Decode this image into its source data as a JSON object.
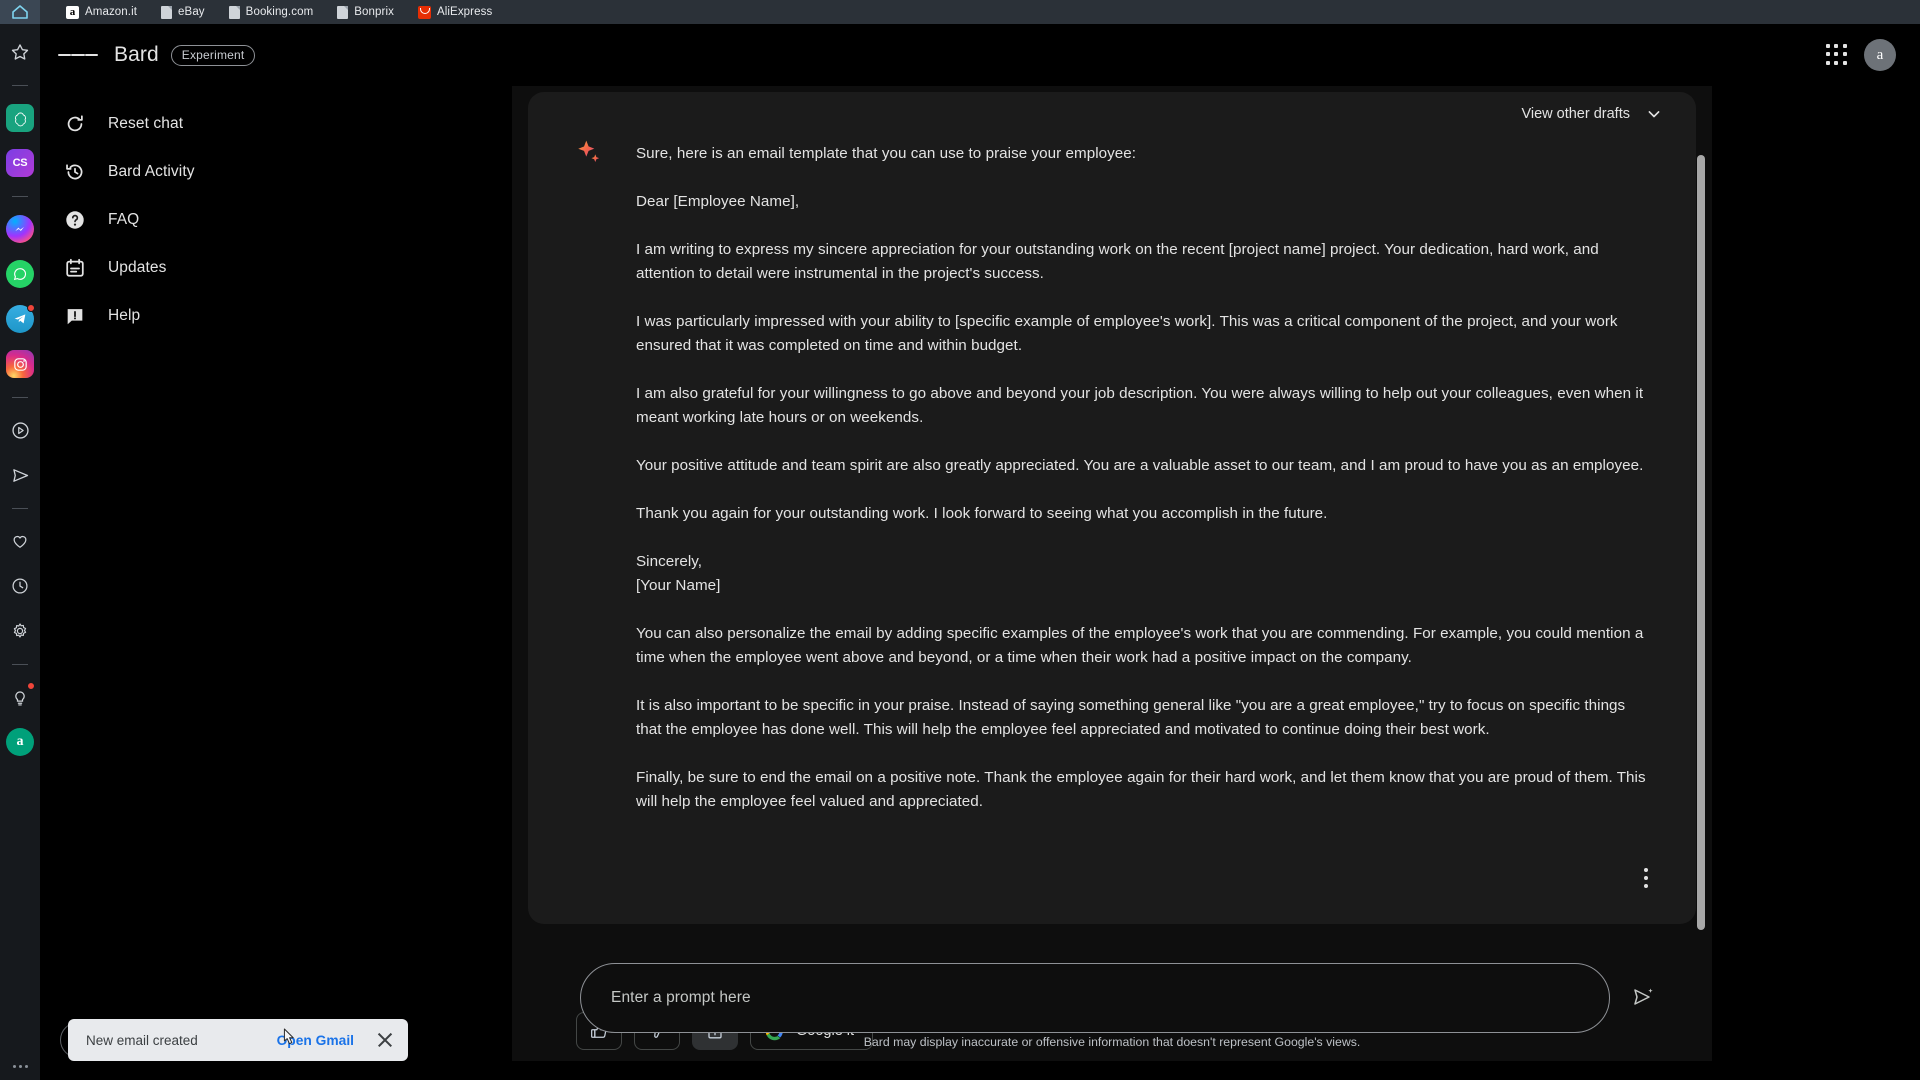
{
  "browser": {
    "home_icon": "home-icon",
    "bookmarks": [
      {
        "label": "Amazon.it",
        "icon": "amazon-favicon"
      },
      {
        "label": "eBay",
        "icon": "document-favicon"
      },
      {
        "label": "Booking.com",
        "icon": "document-favicon"
      },
      {
        "label": "Bonprix",
        "icon": "document-favicon"
      },
      {
        "label": "AliExpress",
        "icon": "aliexpress-favicon"
      }
    ]
  },
  "rail": {
    "items": [
      {
        "name": "star-icon",
        "label": "Star"
      },
      {
        "name": "separator",
        "label": ""
      },
      {
        "name": "chatgpt-icon",
        "label": "ChatGPT"
      },
      {
        "name": "cs-icon",
        "label": "CS"
      },
      {
        "name": "separator",
        "label": ""
      },
      {
        "name": "messenger-icon",
        "label": "Messenger"
      },
      {
        "name": "whatsapp-icon",
        "label": "WhatsApp"
      },
      {
        "name": "telegram-icon",
        "label": "Telegram"
      },
      {
        "name": "instagram-icon",
        "label": "Instagram"
      },
      {
        "name": "separator",
        "label": ""
      },
      {
        "name": "play-circle-icon",
        "label": "Play"
      },
      {
        "name": "send-icon",
        "label": "Send"
      },
      {
        "name": "separator",
        "label": ""
      },
      {
        "name": "heart-icon",
        "label": "Favorites"
      },
      {
        "name": "clock-icon",
        "label": "History"
      },
      {
        "name": "gear-icon",
        "label": "Settings"
      },
      {
        "name": "separator",
        "label": ""
      },
      {
        "name": "lightbulb-icon",
        "label": "Tips"
      },
      {
        "name": "account-a-icon",
        "label": "a"
      }
    ],
    "overflow": "more-options"
  },
  "header": {
    "menu_icon": "hamburger-icon",
    "title": "Bard",
    "badge": "Experiment",
    "apps_icon": "google-apps-icon",
    "avatar_initial": "a"
  },
  "sidenav": {
    "items": [
      {
        "label": "Reset chat",
        "icon": "reset-icon"
      },
      {
        "label": "Bard Activity",
        "icon": "history-icon"
      },
      {
        "label": "FAQ",
        "icon": "help-circle-icon"
      },
      {
        "label": "Updates",
        "icon": "calendar-icon"
      },
      {
        "label": "Help",
        "icon": "feedback-icon"
      }
    ]
  },
  "drafts": {
    "label": "View other drafts",
    "chevron": "chevron-down-icon"
  },
  "response": {
    "avatar_icon": "bard-sparkle-icon",
    "paragraphs": [
      "Sure, here is an email template that you can use to praise your employee:",
      "Dear [Employee Name],",
      "I am writing to express my sincere appreciation for your outstanding work on the recent [project name] project. Your dedication, hard work, and attention to detail were instrumental in the project's success.",
      "I was particularly impressed with your ability to [specific example of employee's work]. This was a critical component of the project, and your work ensured that it was completed on time and within budget.",
      "I am also grateful for your willingness to go above and beyond your job description. You were always willing to help out your colleagues, even when it meant working late hours or on weekends.",
      "Your positive attitude and team spirit are also greatly appreciated. You are a valuable asset to our team, and I am proud to have you as an employee.",
      "Thank you again for your outstanding work. I look forward to seeing what you accomplish in the future.",
      "Sincerely,",
      "[Your Name]",
      "You can also personalize the email by adding specific examples of the employee's work that you are commending. For example, you could mention a time when the employee went above and beyond, or a time when their work had a positive impact on the company.",
      "It is also important to be specific in your praise. Instead of saying something general like \"you are a great employee,\" try to focus on specific things that the employee has done well. This will help the employee feel appreciated and motivated to continue doing their best work.",
      "Finally, be sure to end the email on a positive note. Thank the employee again for their hard work, and let them know that you are proud of them. This will help the employee feel valued and appreciated."
    ]
  },
  "actions": {
    "thumbs_up": "thumb-up-icon",
    "thumbs_down": "thumb-down-icon",
    "share": "share-icon",
    "google_it_label": "Google it",
    "google_logo": "google-g-icon",
    "more": "more-vertical-icon"
  },
  "prompt": {
    "placeholder": "Enter a prompt here",
    "send_icon": "send-sparkle-icon",
    "disclaimer": "Bard may display inaccurate or offensive information that doesn't represent Google's views."
  },
  "toast": {
    "message": "New email created",
    "action_label": "Open Gmail",
    "close_icon": "close-icon"
  },
  "colors": {
    "page_bg": "#000000",
    "card_bg": "#1b1b1b",
    "panel_bg": "#0e0e0e",
    "rail_bg": "#16191d",
    "bookmarks_bg": "#2b3138",
    "text_primary": "#e3e3e3",
    "link_blue": "#1a73e8",
    "toast_bg": "#e8eaed"
  }
}
